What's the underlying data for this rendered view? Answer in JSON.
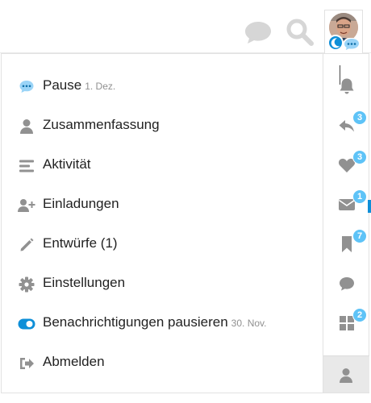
{
  "colors": {
    "accent": "#0e8fd8",
    "badge": "#5ec3f7",
    "icon_gray": "#919191",
    "header_icon": "#d6d6d6"
  },
  "header": {
    "icons": [
      "chat-icon",
      "search-icon"
    ],
    "avatar": {
      "status_icon": "moon-icon",
      "chat_status_icon": "ellipsis-chat-icon"
    }
  },
  "menu": {
    "items": [
      {
        "label": "Pause",
        "date": "1. Dez.",
        "icon": "ellipsis-chat-icon"
      },
      {
        "label": "Zusammenfassung",
        "icon": "user-icon"
      },
      {
        "label": "Aktivität",
        "icon": "stream-icon"
      },
      {
        "label": "Einladungen",
        "icon": "user-plus-icon"
      },
      {
        "label": "Entwürfe (1)",
        "icon": "pencil-icon"
      },
      {
        "label": "Einstellungen",
        "icon": "gear-icon"
      },
      {
        "label": "Benachrichtigungen pausieren",
        "date": "30. Nov.",
        "icon": "toggle-on-icon"
      },
      {
        "label": "Abmelden",
        "icon": "sign-out-icon"
      }
    ]
  },
  "sidebar": {
    "items": [
      {
        "icon": "bell-icon",
        "badge": ""
      },
      {
        "icon": "reply-icon",
        "badge": "3"
      },
      {
        "icon": "heart-icon",
        "badge": "3"
      },
      {
        "icon": "envelope-icon",
        "badge": "1"
      },
      {
        "icon": "bookmark-icon",
        "badge": "7"
      },
      {
        "icon": "chat-bubble-icon",
        "badge": ""
      },
      {
        "icon": "grid-icon",
        "badge": "2"
      },
      {
        "icon": "user-icon",
        "badge": ""
      }
    ]
  }
}
